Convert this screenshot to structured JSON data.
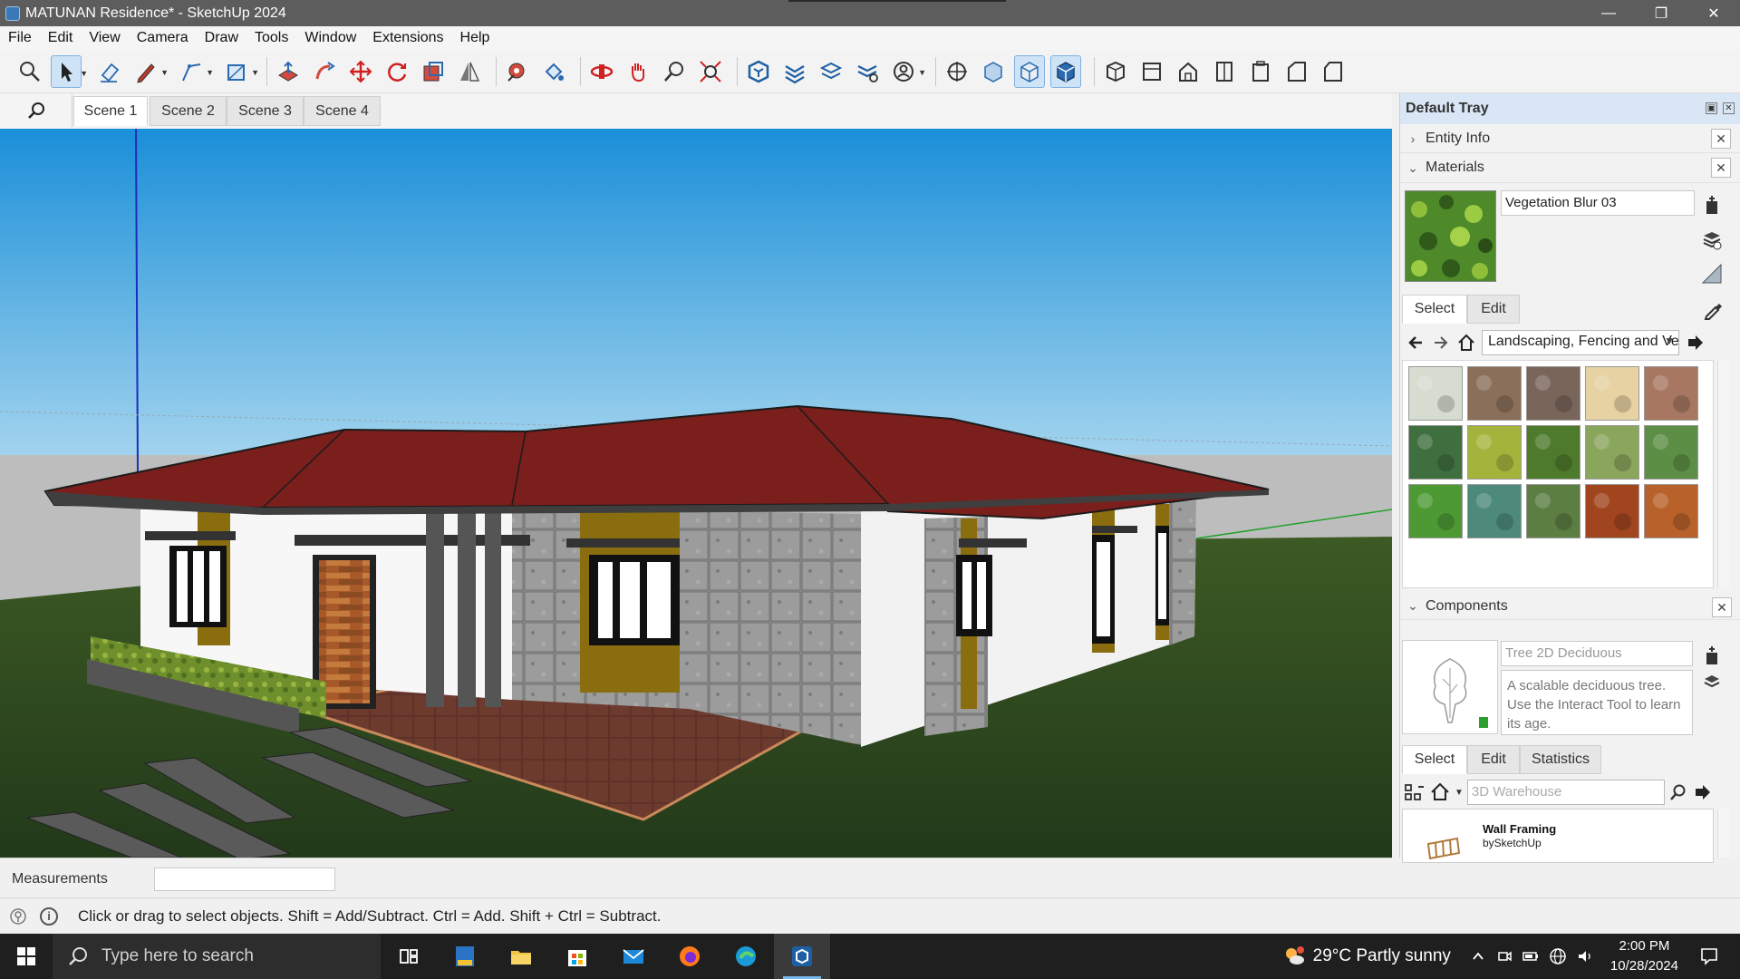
{
  "window": {
    "title": "MATUNAN Residence* - SketchUp 2024",
    "min": "—",
    "max": "❐",
    "close": "✕"
  },
  "menu": [
    "File",
    "Edit",
    "View",
    "Camera",
    "Draw",
    "Tools",
    "Window",
    "Extensions",
    "Help"
  ],
  "scenes": {
    "tabs": [
      "Scene 1",
      "Scene 2",
      "Scene 3",
      "Scene 4"
    ],
    "active": "Scene 1"
  },
  "measurements": {
    "label": "Measurements",
    "value": ""
  },
  "status": {
    "message": "Click or drag to select objects. Shift = Add/Subtract. Ctrl = Add. Shift + Ctrl = Subtract."
  },
  "tray": {
    "title": "Default Tray",
    "entity_info": {
      "label": "Entity Info",
      "close": "✕"
    },
    "materials": {
      "label": "Materials",
      "close": "✕",
      "current_name": "Vegetation Blur 03",
      "tabs": {
        "select": "Select",
        "edit": "Edit"
      },
      "collection": "Landscaping, Fencing and Vegetation",
      "swatch_colors": [
        "#d7dcd0",
        "#8a6f5a",
        "#7a655a",
        "#e6d2a3",
        "#a77762",
        "#3f6f3e",
        "#a3b43c",
        "#4e7a2b",
        "#8aa55c",
        "#5c8f45",
        "#4d9a35",
        "#4d8a7c",
        "#5c7e43",
        "#a0451e",
        "#b8612a"
      ]
    },
    "components": {
      "label": "Components",
      "close": "✕",
      "name_placeholder": "Tree 2D Deciduous",
      "description": "A scalable deciduous tree.  Use the Interact Tool to learn its age.",
      "tabs": {
        "select": "Select",
        "edit": "Edit",
        "statistics": "Statistics"
      },
      "search_placeholder": "3D Warehouse",
      "result": {
        "title": "Wall Framing",
        "author": "bySketchUp"
      }
    }
  },
  "taskbar": {
    "search_placeholder": "Type here to search",
    "weather": "29°C  Partly sunny",
    "time": "2:00 PM",
    "date": "10/28/2024"
  },
  "colors": {
    "accent": "#0078d7",
    "sky_top": "#1a8fd8",
    "sky_bottom": "#a9d7ef",
    "roof": "#7a1f1c",
    "grass": "#2f4f1e"
  }
}
